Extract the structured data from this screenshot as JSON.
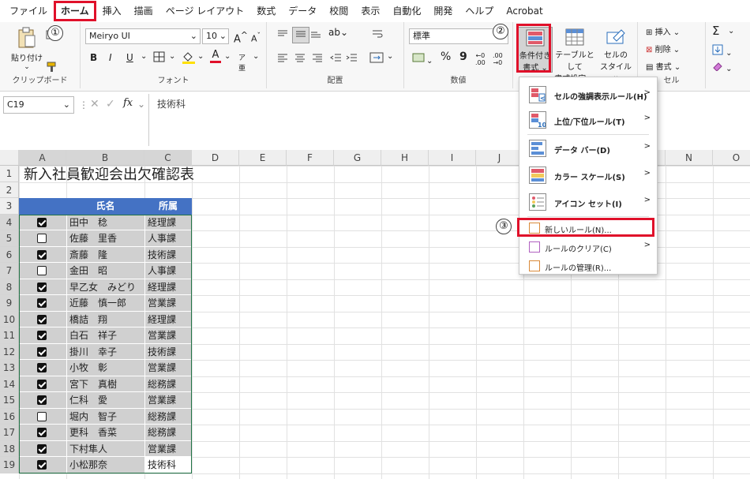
{
  "menu": [
    "ファイル",
    "ホーム",
    "挿入",
    "描画",
    "ページ レイアウト",
    "数式",
    "データ",
    "校閲",
    "表示",
    "自動化",
    "開発",
    "ヘルプ",
    "Acrobat"
  ],
  "ribbon": {
    "clipboard": {
      "paste": "貼り付け",
      "label": "クリップボード"
    },
    "font": {
      "name": "Meiryo UI",
      "size": "10",
      "bold": "B",
      "italic": "I",
      "underline": "U",
      "grow": "A^",
      "shrink": "A",
      "label": "フォント"
    },
    "alignment": {
      "label": "配置"
    },
    "number": {
      "format": "標準",
      "label": "数値",
      "percent": "%",
      "comma": "9"
    },
    "styles": {
      "cond_format": [
        "条件付き",
        "書式 ⌄"
      ],
      "as_table": [
        "テーブルとして",
        "書式設定 ⌄"
      ],
      "cell_styles": [
        "セルの",
        "スタイル ⌄"
      ]
    },
    "cells": {
      "insert": "挿入",
      "delete": "削除",
      "format": "書式",
      "label": "セル"
    },
    "editing": {
      "sum": "Σ"
    }
  },
  "formula_bar": {
    "name_box": "C19",
    "fx": "fx",
    "value": "技術科"
  },
  "columns": [
    "A",
    "B",
    "C",
    "D",
    "E",
    "F",
    "G",
    "H",
    "I",
    "J",
    "K",
    "L",
    "M",
    "N",
    "O"
  ],
  "sheet": {
    "title": "新入社員歓迎会出欠確認表",
    "header": {
      "name": "氏名",
      "dept": "所属"
    },
    "rows": [
      {
        "n": "4",
        "checked": true,
        "name": "田中　稔",
        "dept": "経理課"
      },
      {
        "n": "5",
        "checked": false,
        "name": "佐藤　里香",
        "dept": "人事課"
      },
      {
        "n": "6",
        "checked": true,
        "name": "斎藤　隆",
        "dept": "技術課"
      },
      {
        "n": "7",
        "checked": false,
        "name": "金田　昭",
        "dept": "人事課"
      },
      {
        "n": "8",
        "checked": true,
        "name": "早乙女　みどり",
        "dept": "経理課"
      },
      {
        "n": "9",
        "checked": true,
        "name": "近藤　慎一郎",
        "dept": "営業課"
      },
      {
        "n": "10",
        "checked": true,
        "name": "橋詰　翔",
        "dept": "経理課"
      },
      {
        "n": "11",
        "checked": true,
        "name": "白石　祥子",
        "dept": "営業課"
      },
      {
        "n": "12",
        "checked": true,
        "name": "掛川　幸子",
        "dept": "技術課"
      },
      {
        "n": "13",
        "checked": true,
        "name": "小牧　彰",
        "dept": "営業課"
      },
      {
        "n": "14",
        "checked": true,
        "name": "宮下　真樹",
        "dept": "総務課"
      },
      {
        "n": "15",
        "checked": true,
        "name": "仁科　愛",
        "dept": "営業課"
      },
      {
        "n": "16",
        "checked": false,
        "name": "堀内　智子",
        "dept": "総務課"
      },
      {
        "n": "17",
        "checked": true,
        "name": "更科　香菜",
        "dept": "総務課"
      },
      {
        "n": "18",
        "checked": true,
        "name": "下村隼人",
        "dept": "営業課"
      },
      {
        "n": "19",
        "checked": true,
        "name": "小松那奈",
        "dept": "技術科"
      }
    ]
  },
  "row_numbers_top": [
    "1",
    "2",
    "3"
  ],
  "dropdown": {
    "items": [
      {
        "label": "セルの強調表示ルール(H)",
        "arrow": ">"
      },
      {
        "label": "上位/下位ルール(T)",
        "arrow": ">"
      },
      {
        "label": "データ バー(D)",
        "arrow": ">"
      },
      {
        "label": "カラー スケール(S)",
        "arrow": ">"
      },
      {
        "label": "アイコン セット(I)",
        "arrow": ">"
      }
    ],
    "new_rule": "新しいルール(N)...",
    "clear": "ルールのクリア(C)",
    "clear_arrow": ">",
    "manage": "ルールの管理(R)..."
  },
  "callouts": [
    "①",
    "②",
    "③"
  ],
  "colors": {
    "accent": "#e0102a",
    "header_fill": "#4472c4",
    "grey_fill": "#d0d0d0",
    "select_green": "#217346"
  }
}
